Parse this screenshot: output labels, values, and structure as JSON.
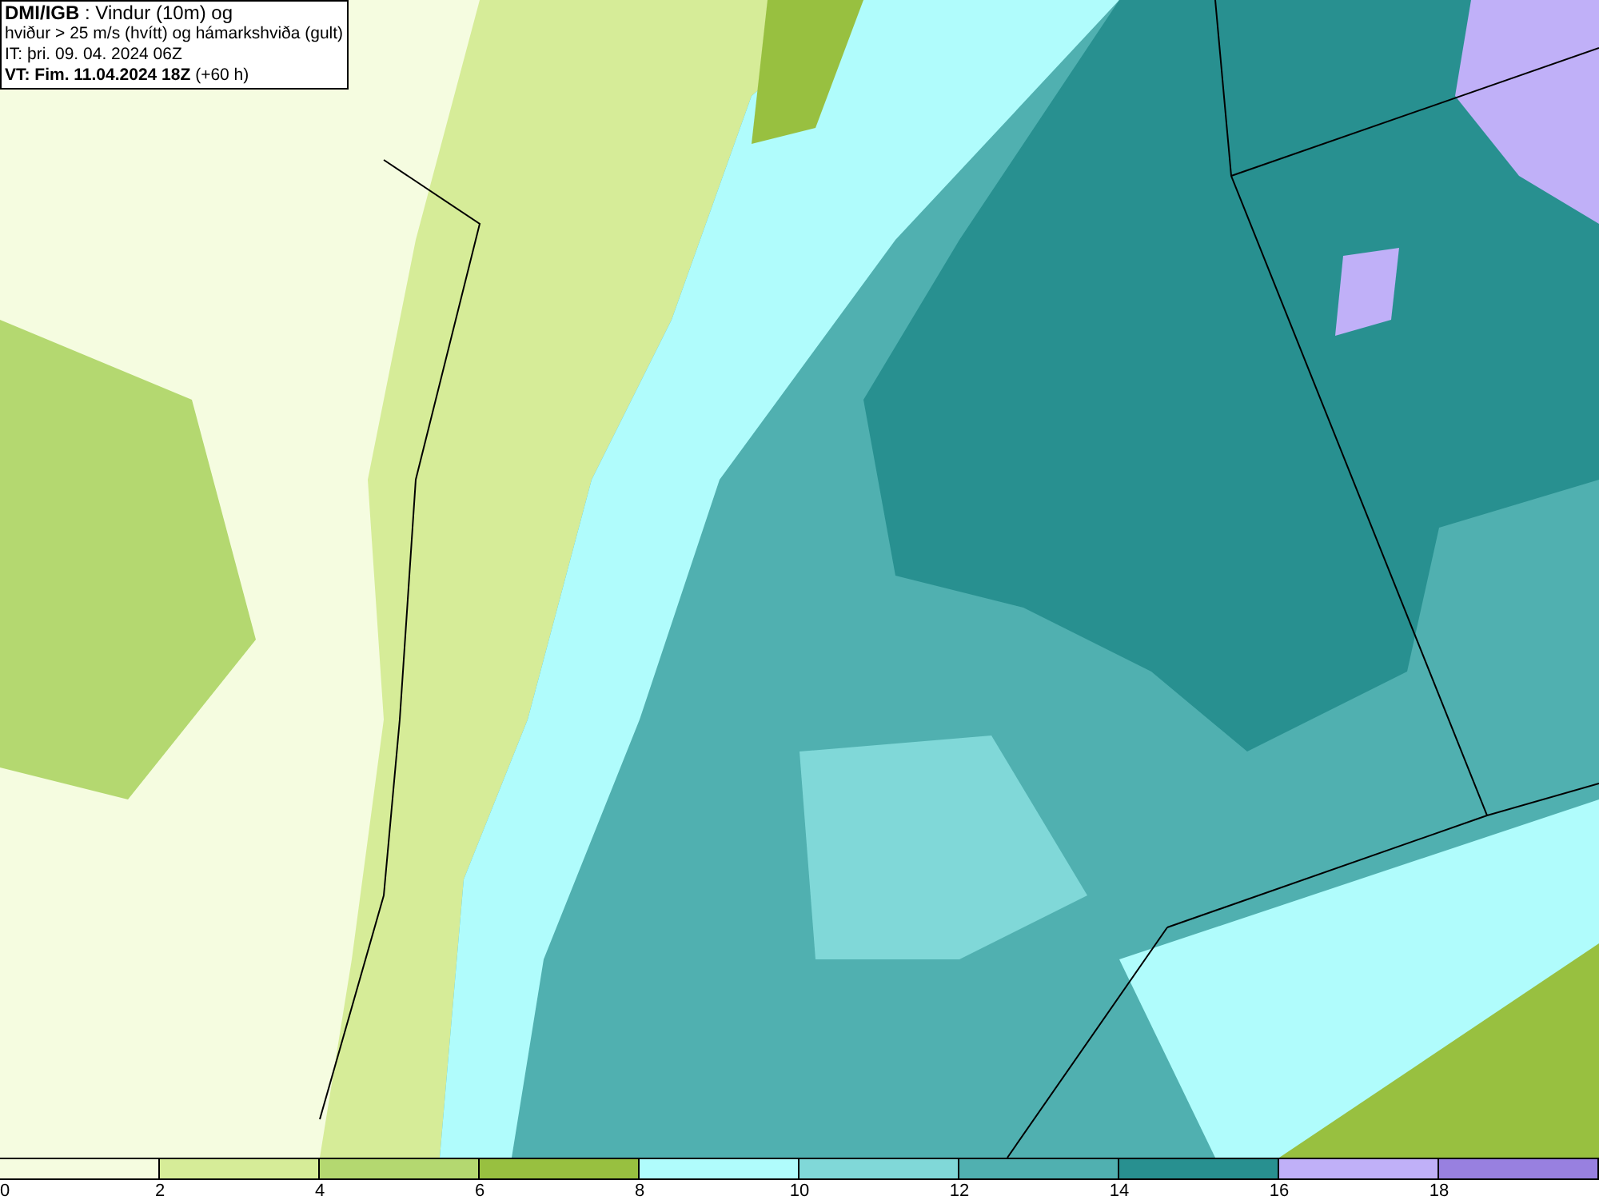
{
  "title_box": {
    "lines": [
      "**DMI/IGB** : Vindur (10m) og",
      "hviður > 25 m/s (hvítt) og hámarkshviða (gult)",
      "IT: þri. 09. 04. 2024 06Z",
      "**VT: Fim. 11.04.2024 18Z** (+60 h)"
    ]
  },
  "legend": {
    "bins": [
      {
        "color": "#f5fce0"
      },
      {
        "color": "#d6ec98"
      },
      {
        "color": "#b4d870"
      },
      {
        "color": "#98c040"
      },
      {
        "color": "#b0fcfc"
      },
      {
        "color": "#80d8d8"
      },
      {
        "color": "#50b0b0"
      },
      {
        "color": "#289090"
      },
      {
        "color": "#c0b0f8"
      },
      {
        "color": "#9880e0"
      }
    ],
    "ticks": [
      "0",
      "2",
      "4",
      "6",
      "8",
      "10",
      "12",
      "14",
      "16",
      "18"
    ]
  }
}
